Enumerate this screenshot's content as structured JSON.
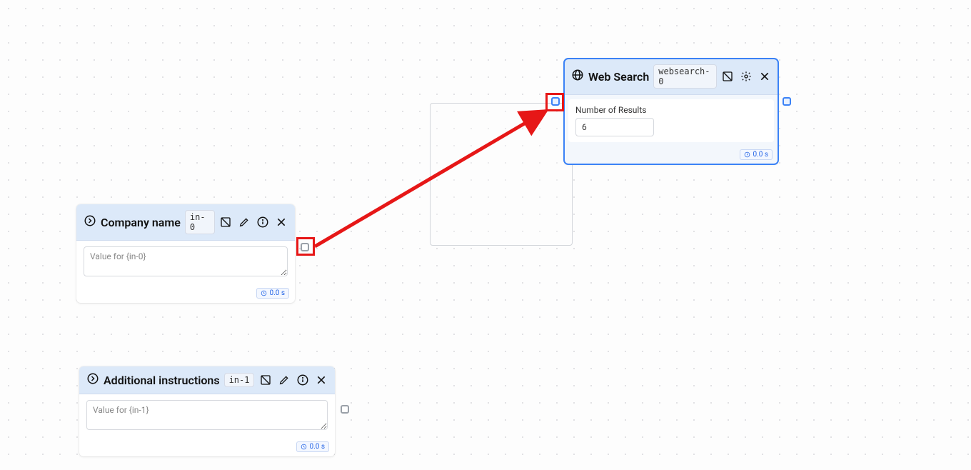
{
  "nodes": {
    "company": {
      "title": "Company name",
      "tag": "in-0",
      "placeholder": "Value for {in-0}",
      "time": "0.0 s"
    },
    "additional": {
      "title": "Additional instructions",
      "tag": "in-1",
      "placeholder": "Value for {in-1}",
      "time": "0.0 s"
    },
    "websearch": {
      "title": "Web Search",
      "tag": "websearch-0",
      "field_label": "Number of Results",
      "value": "6",
      "time": "0.0 s"
    }
  }
}
